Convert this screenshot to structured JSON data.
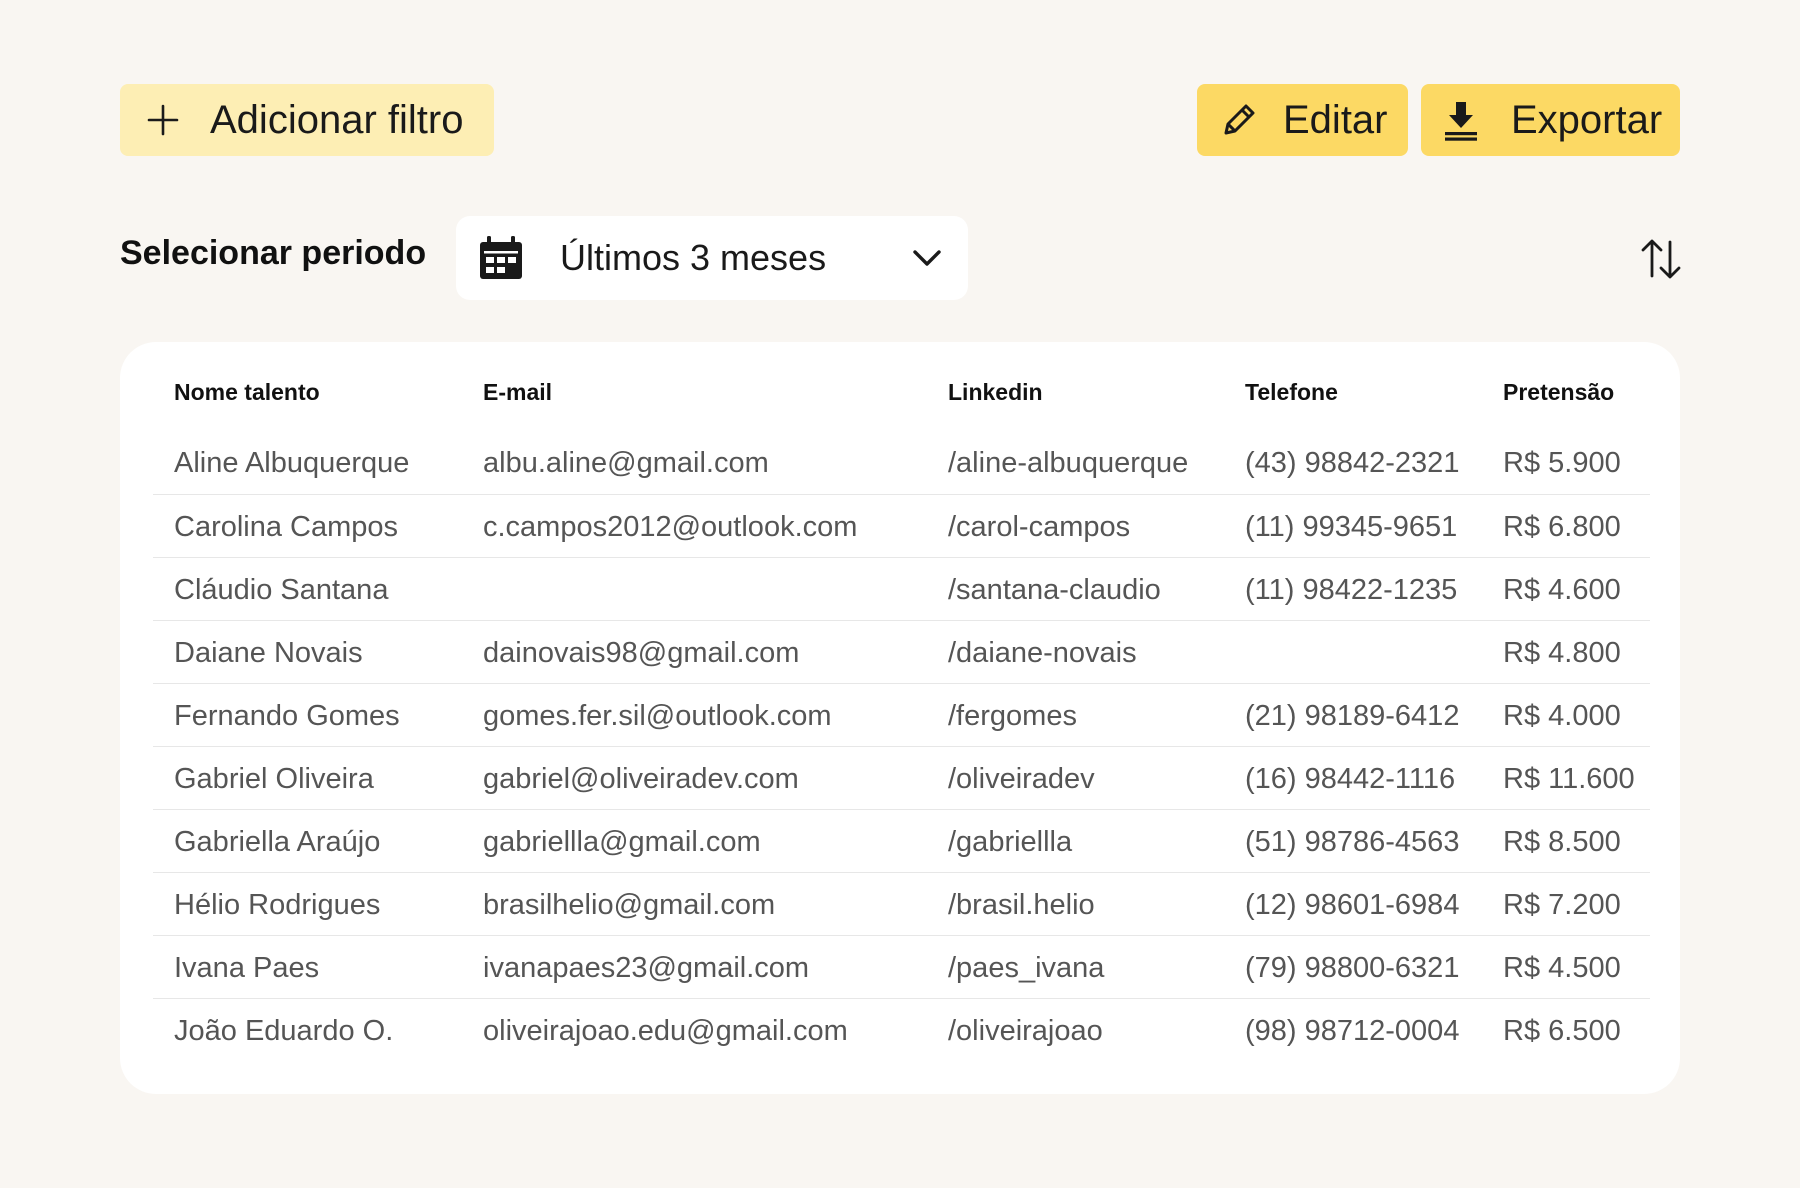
{
  "toolbar": {
    "add_filter_label": "Adicionar filtro",
    "edit_label": "Editar",
    "export_label": "Exportar"
  },
  "period": {
    "label": "Selecionar periodo",
    "selected": "Últimos 3 meses"
  },
  "icons": {
    "add": "plus-icon",
    "edit": "pencil-icon",
    "export": "download-icon",
    "calendar": "calendar-icon",
    "dropdown": "chevron-down-icon",
    "sort": "sort-arrows-icon"
  },
  "colors": {
    "background": "#f9f6f2",
    "filter_button": "#fdeeb4",
    "primary_button": "#fcd964",
    "card": "#ffffff",
    "row_text": "#555555"
  },
  "table": {
    "headers": {
      "name": "Nome talento",
      "email": "E-mail",
      "linkedin": "Linkedin",
      "phone": "Telefone",
      "salary": "Pretensão"
    },
    "rows": [
      {
        "name": "Aline Albuquerque",
        "email": "albu.aline@gmail.com",
        "linkedin": "/aline-albuquerque",
        "phone": "(43) 98842-2321",
        "salary": "R$ 5.900"
      },
      {
        "name": "Carolina Campos",
        "email": "c.campos2012@outlook.com",
        "linkedin": "/carol-campos",
        "phone": "(11) 99345-9651",
        "salary": "R$ 6.800"
      },
      {
        "name": "Cláudio Santana",
        "email": "",
        "linkedin": "/santana-claudio",
        "phone": "(11) 98422-1235",
        "salary": "R$ 4.600"
      },
      {
        "name": "Daiane Novais",
        "email": "dainovais98@gmail.com",
        "linkedin": "/daiane-novais",
        "phone": "",
        "salary": "R$ 4.800"
      },
      {
        "name": "Fernando Gomes",
        "email": "gomes.fer.sil@outlook.com",
        "linkedin": "/fergomes",
        "phone": "(21) 98189-6412",
        "salary": "R$ 4.000"
      },
      {
        "name": "Gabriel Oliveira",
        "email": "gabriel@oliveiradev.com",
        "linkedin": "/oliveiradev",
        "phone": "(16) 98442-1116",
        "salary": "R$ 11.600"
      },
      {
        "name": "Gabriella Araújo",
        "email": "gabriellla@gmail.com",
        "linkedin": "/gabriellla",
        "phone": "(51) 98786-4563",
        "salary": "R$ 8.500"
      },
      {
        "name": "Hélio Rodrigues",
        "email": "brasilhelio@gmail.com",
        "linkedin": "/brasil.helio",
        "phone": "(12) 98601-6984",
        "salary": "R$ 7.200"
      },
      {
        "name": "Ivana Paes",
        "email": "ivanapaes23@gmail.com",
        "linkedin": "/paes_ivana",
        "phone": "(79) 98800-6321",
        "salary": "R$ 4.500"
      },
      {
        "name": "João Eduardo O.",
        "email": "oliveirajoao.edu@gmail.com",
        "linkedin": "/oliveirajoao",
        "phone": "(98) 98712-0004",
        "salary": "R$ 6.500"
      }
    ]
  }
}
